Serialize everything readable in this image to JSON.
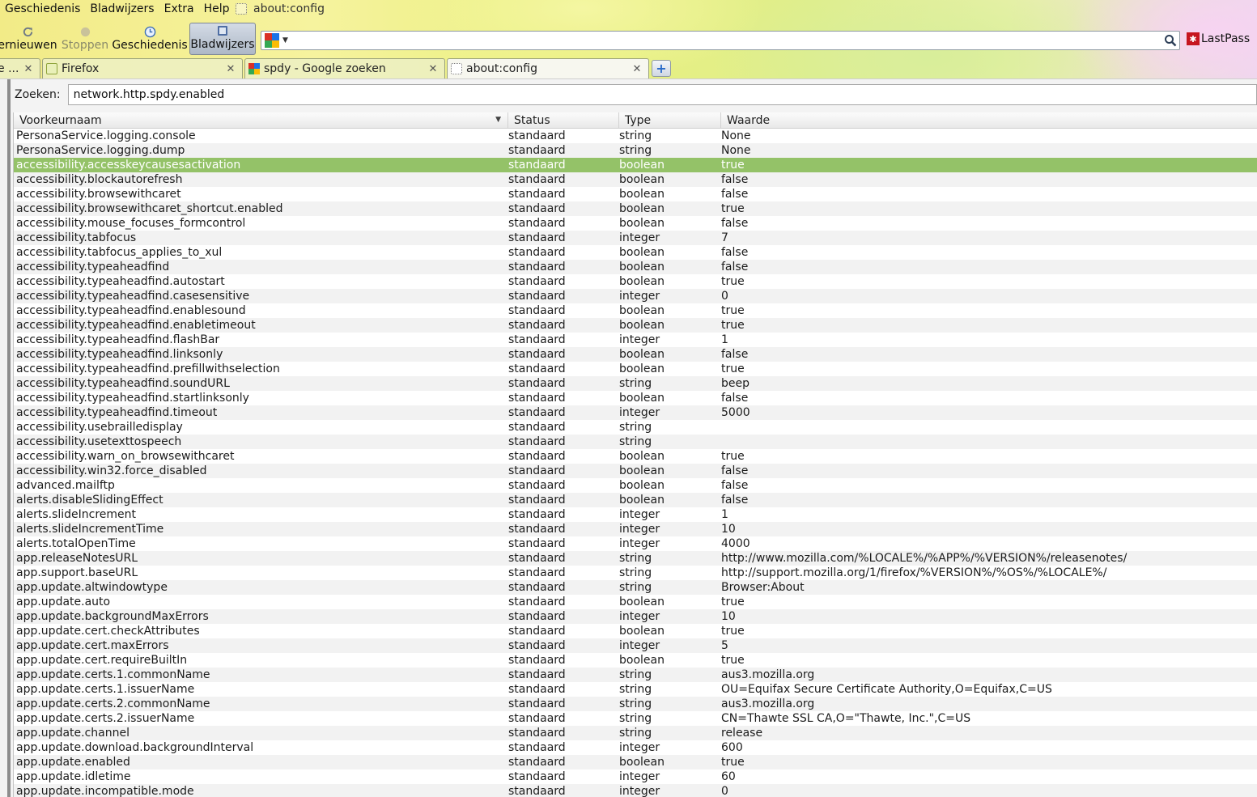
{
  "menubar": {
    "items": [
      "Geschiedenis",
      "Bladwijzers",
      "Extra",
      "Help"
    ],
    "underline": [
      "G",
      "l",
      "x",
      "H"
    ]
  },
  "window_title": "about:config",
  "toolbar": {
    "reload_label": "ernieuwen",
    "stop_label": "Stoppen",
    "history_label": "Geschiedenis",
    "bookmarks_label": "Bladwijzers",
    "url_value": "",
    "lastpass_label": "LastPass"
  },
  "tabs": [
    {
      "label": "e ...",
      "icon": "partial-tab"
    },
    {
      "label": "Firefox",
      "icon": "firefox-page-icon"
    },
    {
      "label": "spdy - Google zoeken",
      "icon": "google-icon"
    },
    {
      "label": "about:config",
      "icon": "blank-page-icon"
    }
  ],
  "colors": {
    "selection": "#94c268",
    "lastpass": "#c6161f",
    "newtab_plus": "#2a6cc9"
  },
  "search": {
    "label": "Zoeken:",
    "value": "network.http.spdy.enabled"
  },
  "columns": [
    "Voorkeurnaam",
    "Status",
    "Type",
    "Waarde"
  ],
  "selected_row_index": 2,
  "rows": [
    [
      "PersonaService.logging.console",
      "standaard",
      "string",
      "None"
    ],
    [
      "PersonaService.logging.dump",
      "standaard",
      "string",
      "None"
    ],
    [
      "accessibility.accesskeycausesactivation",
      "standaard",
      "boolean",
      "true"
    ],
    [
      "accessibility.blockautorefresh",
      "standaard",
      "boolean",
      "false"
    ],
    [
      "accessibility.browsewithcaret",
      "standaard",
      "boolean",
      "false"
    ],
    [
      "accessibility.browsewithcaret_shortcut.enabled",
      "standaard",
      "boolean",
      "true"
    ],
    [
      "accessibility.mouse_focuses_formcontrol",
      "standaard",
      "boolean",
      "false"
    ],
    [
      "accessibility.tabfocus",
      "standaard",
      "integer",
      "7"
    ],
    [
      "accessibility.tabfocus_applies_to_xul",
      "standaard",
      "boolean",
      "false"
    ],
    [
      "accessibility.typeaheadfind",
      "standaard",
      "boolean",
      "false"
    ],
    [
      "accessibility.typeaheadfind.autostart",
      "standaard",
      "boolean",
      "true"
    ],
    [
      "accessibility.typeaheadfind.casesensitive",
      "standaard",
      "integer",
      "0"
    ],
    [
      "accessibility.typeaheadfind.enablesound",
      "standaard",
      "boolean",
      "true"
    ],
    [
      "accessibility.typeaheadfind.enabletimeout",
      "standaard",
      "boolean",
      "true"
    ],
    [
      "accessibility.typeaheadfind.flashBar",
      "standaard",
      "integer",
      "1"
    ],
    [
      "accessibility.typeaheadfind.linksonly",
      "standaard",
      "boolean",
      "false"
    ],
    [
      "accessibility.typeaheadfind.prefillwithselection",
      "standaard",
      "boolean",
      "true"
    ],
    [
      "accessibility.typeaheadfind.soundURL",
      "standaard",
      "string",
      "beep"
    ],
    [
      "accessibility.typeaheadfind.startlinksonly",
      "standaard",
      "boolean",
      "false"
    ],
    [
      "accessibility.typeaheadfind.timeout",
      "standaard",
      "integer",
      "5000"
    ],
    [
      "accessibility.usebrailledisplay",
      "standaard",
      "string",
      ""
    ],
    [
      "accessibility.usetexttospeech",
      "standaard",
      "string",
      ""
    ],
    [
      "accessibility.warn_on_browsewithcaret",
      "standaard",
      "boolean",
      "true"
    ],
    [
      "accessibility.win32.force_disabled",
      "standaard",
      "boolean",
      "false"
    ],
    [
      "advanced.mailftp",
      "standaard",
      "boolean",
      "false"
    ],
    [
      "alerts.disableSlidingEffect",
      "standaard",
      "boolean",
      "false"
    ],
    [
      "alerts.slideIncrement",
      "standaard",
      "integer",
      "1"
    ],
    [
      "alerts.slideIncrementTime",
      "standaard",
      "integer",
      "10"
    ],
    [
      "alerts.totalOpenTime",
      "standaard",
      "integer",
      "4000"
    ],
    [
      "app.releaseNotesURL",
      "standaard",
      "string",
      "http://www.mozilla.com/%LOCALE%/%APP%/%VERSION%/releasenotes/"
    ],
    [
      "app.support.baseURL",
      "standaard",
      "string",
      "http://support.mozilla.org/1/firefox/%VERSION%/%OS%/%LOCALE%/"
    ],
    [
      "app.update.altwindowtype",
      "standaard",
      "string",
      "Browser:About"
    ],
    [
      "app.update.auto",
      "standaard",
      "boolean",
      "true"
    ],
    [
      "app.update.backgroundMaxErrors",
      "standaard",
      "integer",
      "10"
    ],
    [
      "app.update.cert.checkAttributes",
      "standaard",
      "boolean",
      "true"
    ],
    [
      "app.update.cert.maxErrors",
      "standaard",
      "integer",
      "5"
    ],
    [
      "app.update.cert.requireBuiltIn",
      "standaard",
      "boolean",
      "true"
    ],
    [
      "app.update.certs.1.commonName",
      "standaard",
      "string",
      "aus3.mozilla.org"
    ],
    [
      "app.update.certs.1.issuerName",
      "standaard",
      "string",
      "OU=Equifax Secure Certificate Authority,O=Equifax,C=US"
    ],
    [
      "app.update.certs.2.commonName",
      "standaard",
      "string",
      "aus3.mozilla.org"
    ],
    [
      "app.update.certs.2.issuerName",
      "standaard",
      "string",
      "CN=Thawte SSL CA,O=\"Thawte, Inc.\",C=US"
    ],
    [
      "app.update.channel",
      "standaard",
      "string",
      "release"
    ],
    [
      "app.update.download.backgroundInterval",
      "standaard",
      "integer",
      "600"
    ],
    [
      "app.update.enabled",
      "standaard",
      "boolean",
      "true"
    ],
    [
      "app.update.idletime",
      "standaard",
      "integer",
      "60"
    ],
    [
      "app.update.incompatible.mode",
      "standaard",
      "integer",
      "0"
    ]
  ]
}
